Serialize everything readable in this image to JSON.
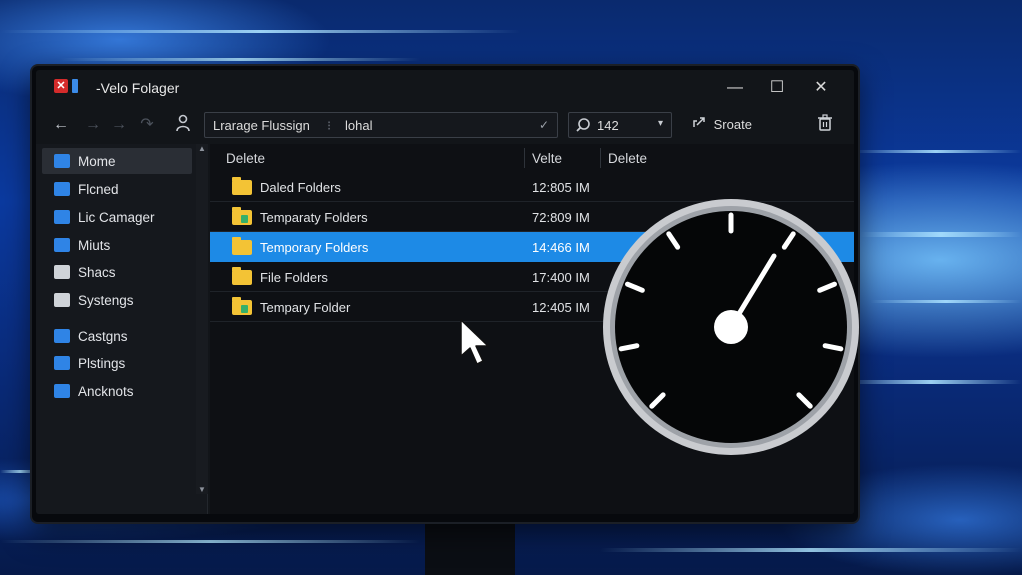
{
  "window": {
    "title": "-Velo Folager",
    "app_icon": "app-logo-icon",
    "controls": {
      "minimize": "—",
      "maximize": "☐",
      "close": "✕"
    }
  },
  "toolbar": {
    "back_icon": "←",
    "forward_icon": "→",
    "forward2_icon": "→",
    "refresh_icon": "↷",
    "user_icon": "user-icon",
    "address": {
      "segment1": "Lrarage Flussign",
      "separator": "⁝",
      "segment2": "lohal",
      "check": "✓"
    },
    "search": {
      "icon": "search-icon",
      "value": "142",
      "dropdown": "▾"
    },
    "action": {
      "icon": "share-icon",
      "label": "Sroate"
    },
    "trash_icon": "trash-icon"
  },
  "sidebar": {
    "items": [
      {
        "label": "Mome",
        "icon": "p-logo-icon",
        "color": "#2f84e6",
        "selected": true
      },
      {
        "label": "Flcned",
        "icon": "folder-icon",
        "color": "#2f84e6"
      },
      {
        "label": "Lic Camager",
        "icon": "chat-icon",
        "color": "#2f84e6"
      },
      {
        "label": "Miuts",
        "icon": "document-icon",
        "color": "#2f84e6"
      },
      {
        "label": "Shacs",
        "icon": "window-icon",
        "color": "#cfd3d8"
      },
      {
        "label": "Systengs",
        "icon": "gear-icon",
        "color": "#cfd3d8"
      },
      {
        "label": "Castgns",
        "icon": "chart-icon",
        "color": "#2f84e6"
      },
      {
        "label": "Plstings",
        "icon": "grid-icon",
        "color": "#2f84e6"
      },
      {
        "label": "Ancknots",
        "icon": "tile-icon",
        "color": "#2f84e6"
      }
    ]
  },
  "files": {
    "columns": [
      "Delete",
      "Velte",
      "Delete"
    ],
    "rows": [
      {
        "name": "Daled Folders",
        "value": "12:805 IM",
        "badge": false,
        "selected": false
      },
      {
        "name": "Temparaty Folders",
        "value": "72:809 IM",
        "badge": true,
        "selected": false
      },
      {
        "name": "Temporary Folders",
        "value": "14:466 IM",
        "badge": false,
        "selected": true
      },
      {
        "name": "File Folders",
        "value": "17:400 IM",
        "badge": false,
        "selected": false
      },
      {
        "name": "Tempary Folder",
        "value": "12:405 IM",
        "badge": true,
        "selected": false
      }
    ]
  },
  "overlay": {
    "gauge_icon": "speedometer-icon",
    "cursor_icon": "mouse-cursor-icon"
  },
  "colors": {
    "accent": "#1d8ae6",
    "folder": "#f3c335",
    "background": "#0b3aa0"
  }
}
